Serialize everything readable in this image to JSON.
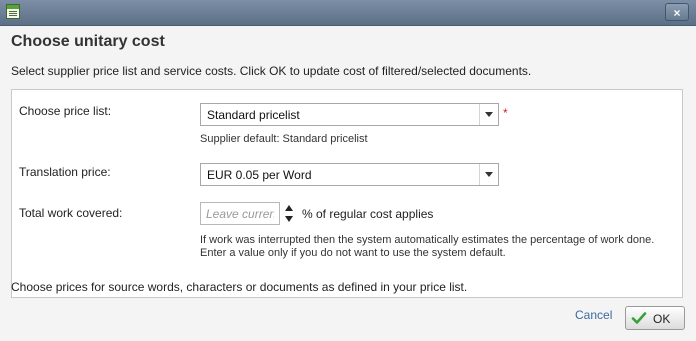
{
  "window": {
    "icon": "form-window-icon",
    "close_label": "×"
  },
  "dialog": {
    "title": "Choose unitary cost",
    "description": "Select supplier price list and service costs. Click OK to update cost of filtered/selected documents."
  },
  "form": {
    "price_list": {
      "label": "Choose price list:",
      "value": "Standard pricelist",
      "required_mark": "*",
      "hint": "Supplier default: Standard pricelist"
    },
    "translation_price": {
      "label": "Translation price:",
      "value": "EUR 0.05 per Word"
    },
    "work_covered": {
      "label": "Total work covered:",
      "placeholder": "Leave current",
      "suffix": "% of regular cost applies",
      "hint_line1": "If work was interrupted then the system automatically estimates the percentage of work done.",
      "hint_line2": "Enter a value only if you do not want to use the system default."
    }
  },
  "footnote": "Choose prices for source words, characters or documents as defined in your price list.",
  "actions": {
    "cancel_label": "Cancel",
    "ok_label": "OK"
  },
  "colors": {
    "titlebar": "#5b6f86",
    "required": "#d81e1e",
    "link": "#3a6a9e",
    "check_icon": "#3aa03a"
  }
}
